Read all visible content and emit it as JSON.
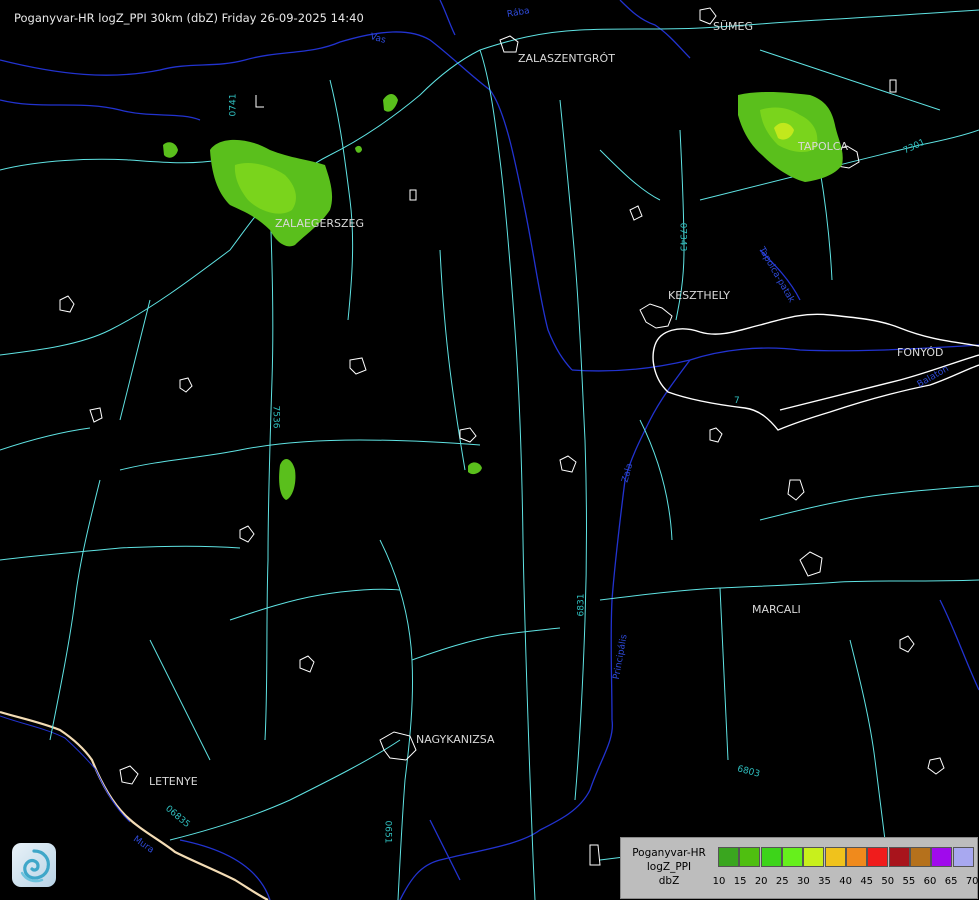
{
  "header": {
    "title": "Poganyvar-HR logZ_PPI 30km (dbZ) Friday 26-09-2025 14:40"
  },
  "places": {
    "sumeg": "SÜMEG",
    "zalaszentgrot": "ZALASZENTGRÓT",
    "zalaegerszeg": "ZALAEGERSZEG",
    "tapolca": "TAPOLCA",
    "keszthely": "KESZTHELY",
    "fonyod": "FONYÓD",
    "marcali": "MARCALI",
    "nagykanizsa": "NAGYKANIZSA",
    "letenye": "LETENYE"
  },
  "roads": {
    "r0741": "0741",
    "r07343": "07343",
    "r7301": "7301",
    "r7536": "7536",
    "r6831": "6831",
    "r6803": "6803",
    "r06835": "06835",
    "r7": "7",
    "r0651": "0651"
  },
  "rivers": {
    "zala": "Zala",
    "raba": "Rába",
    "vas": "Vas",
    "balaton": "Balaton",
    "principalis": "Principális",
    "mura": "Mura",
    "tapolca_patak": "Tapolca-patak"
  },
  "legend": {
    "line1": "Poganyvar-HR",
    "line2": "logZ_PPI",
    "line3": "dbZ",
    "colors": [
      "#3aa61f",
      "#4fbf10",
      "#3dd41a",
      "#66f01c",
      "#c8f01c",
      "#f0c21c",
      "#f08a1c",
      "#f01c1c",
      "#a8141c",
      "#b5711c",
      "#a00aec",
      "#a8a8f0"
    ],
    "ticks": [
      "10",
      "15",
      "20",
      "25",
      "30",
      "35",
      "40",
      "45",
      "50",
      "55",
      "60",
      "65",
      "70"
    ]
  },
  "echoes": {
    "colors": {
      "light": "#5abf1c",
      "mid": "#7ad41c",
      "bright": "#c2e81c"
    }
  },
  "map_colors": {
    "roads": "#5fe3e3",
    "rivers": "#2233d0",
    "settlements": "#ffffff",
    "border": "#f3dcb5"
  }
}
